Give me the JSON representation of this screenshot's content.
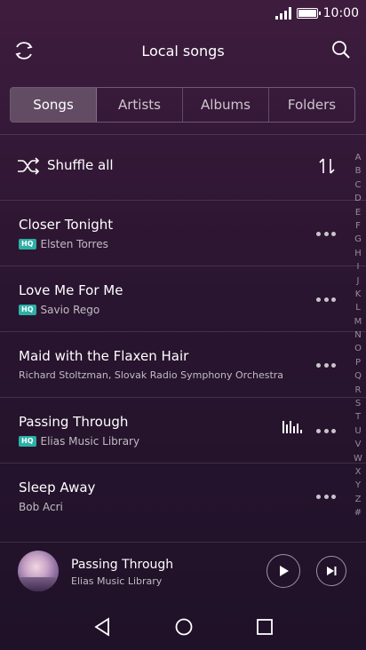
{
  "status": {
    "time": "10:00"
  },
  "header": {
    "title": "Local songs",
    "left_icon": "refresh-icon",
    "right_icon": "search-icon"
  },
  "tabs": [
    {
      "label": "Songs",
      "active": true
    },
    {
      "label": "Artists",
      "active": false
    },
    {
      "label": "Albums",
      "active": false
    },
    {
      "label": "Folders",
      "active": false
    }
  ],
  "shuffle": {
    "label": "Shuffle all",
    "icon": "shuffle-icon",
    "sort_icon": "sort-icon"
  },
  "songs": [
    {
      "title": "Closer Tonight",
      "artist": "Elsten Torres",
      "hq": true,
      "playing": false
    },
    {
      "title": "Love Me For Me",
      "artist": "Savio Rego",
      "hq": true,
      "playing": false
    },
    {
      "title": "Maid with the Flaxen Hair",
      "artist": "Richard Stoltzman, Slovak Radio Symphony Orchestra",
      "hq": false,
      "playing": false
    },
    {
      "title": "Passing Through",
      "artist": "Elias Music Library",
      "hq": true,
      "playing": true
    },
    {
      "title": "Sleep Away",
      "artist": "Bob Acri",
      "hq": false,
      "playing": false
    }
  ],
  "hq_badge": "HQ",
  "alphabet": [
    "A",
    "B",
    "C",
    "D",
    "E",
    "F",
    "G",
    "H",
    "I",
    "J",
    "K",
    "L",
    "M",
    "N",
    "O",
    "P",
    "Q",
    "R",
    "S",
    "T",
    "U",
    "V",
    "W",
    "X",
    "Y",
    "Z",
    "#"
  ],
  "now_playing": {
    "title": "Passing Through",
    "artist": "Elias Music Library"
  },
  "colors": {
    "accent_hq": "#2bb0a6",
    "background_top": "#3e1c3e",
    "background_bottom": "#1f1128"
  }
}
